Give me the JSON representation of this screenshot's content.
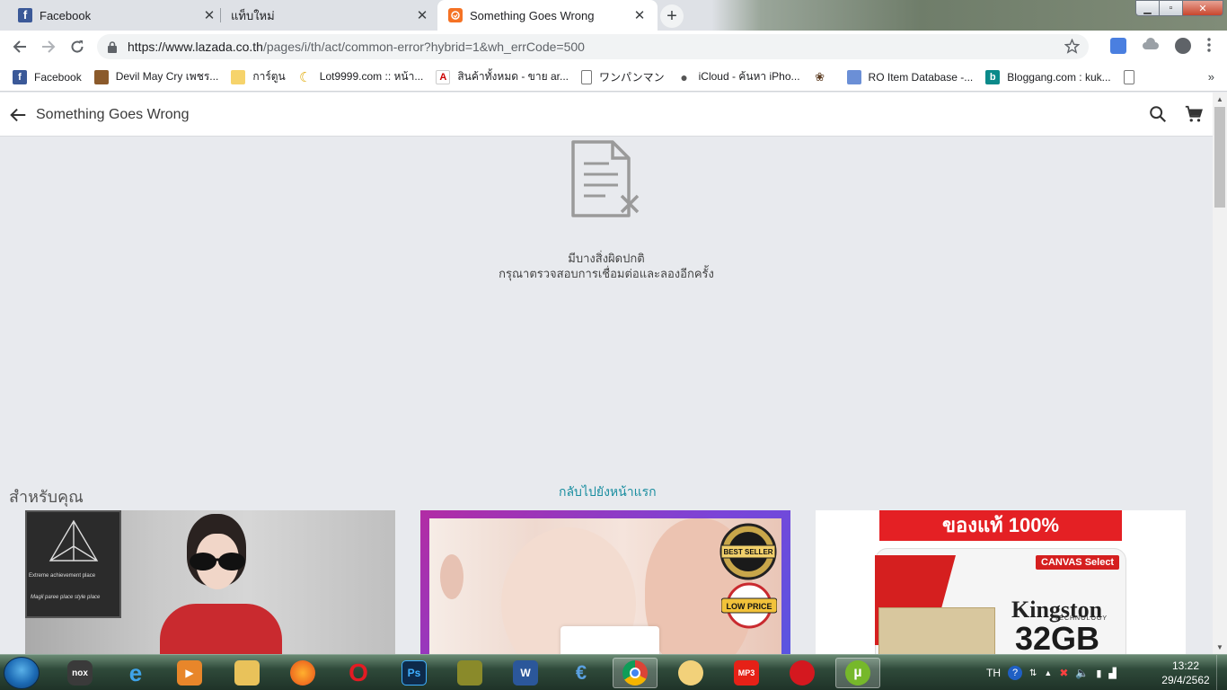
{
  "browser": {
    "tabs": [
      {
        "title": "Facebook",
        "active": false,
        "favicon": "facebook-icon"
      },
      {
        "title": "แท็บใหม่",
        "active": false,
        "favicon": "none"
      },
      {
        "title": "Something Goes Wrong",
        "active": true,
        "favicon": "lazada-icon"
      }
    ],
    "url_host": "https://www.lazada.co.th",
    "url_path": "/pages/i/th/act/common-error?hybrid=1&wh_errCode=500",
    "bookmarks": [
      {
        "label": "Facebook",
        "icon": "facebook-icon"
      },
      {
        "label": "Devil May Cry เพชร...",
        "icon": "devil-icon"
      },
      {
        "label": "การ์ตูน",
        "icon": "folder-icon"
      },
      {
        "label": "Lot9999.com :: หน้า...",
        "icon": "moon-icon"
      },
      {
        "label": "สินค้าทั้งหมด - ขาย ar...",
        "icon": "shop-icon"
      },
      {
        "label": "ワンパンマン",
        "icon": "page-icon"
      },
      {
        "label": "iCloud - ค้นหา iPho...",
        "icon": "apple-icon"
      },
      {
        "label": "",
        "icon": "paw-icon"
      },
      {
        "label": "RO Item Database -...",
        "icon": "ro-icon"
      },
      {
        "label": "Bloggang.com : kuk...",
        "icon": "bloggang-icon"
      },
      {
        "label": "",
        "icon": "page-icon"
      }
    ],
    "bookmarks_more": "»"
  },
  "page": {
    "title": "Something Goes Wrong",
    "error_line1": "มีบางสิ่งผิดปกติ",
    "error_line2": "กรุณาตรวจสอบการเชื่อมต่อและลองอีกครั้ง",
    "for_you": "สำหรับคุณ",
    "back_home": "กลับไปยังหน้าแรก"
  },
  "products": {
    "card1": {
      "text1": "Extreme achievement place",
      "text2": "Magil paree place style place"
    },
    "card2": {
      "badge1": "BEST SELLER",
      "badge2": "LOW PRICE"
    },
    "card3": {
      "banner": "ของแท้ 100%",
      "canvas": "CANVAS Select",
      "brand": "Kingston",
      "tech": "TECHNOLOGY",
      "capacity": "32GB"
    }
  },
  "taskbar": {
    "apps": [
      "nox",
      "internet-explorer",
      "media-player",
      "file-explorer",
      "firefox",
      "opera",
      "photoshop",
      "minecraft",
      "word",
      "cheat-engine",
      "chrome",
      "emoticon",
      "mp3",
      "garena",
      "utorrent"
    ],
    "lang": "TH",
    "time": "13:22",
    "date": "29/4/2562"
  },
  "colors": {
    "accent_link": "#1a8ea0",
    "lazada_orange": "#f57224",
    "page_bg": "#e8eaee"
  }
}
